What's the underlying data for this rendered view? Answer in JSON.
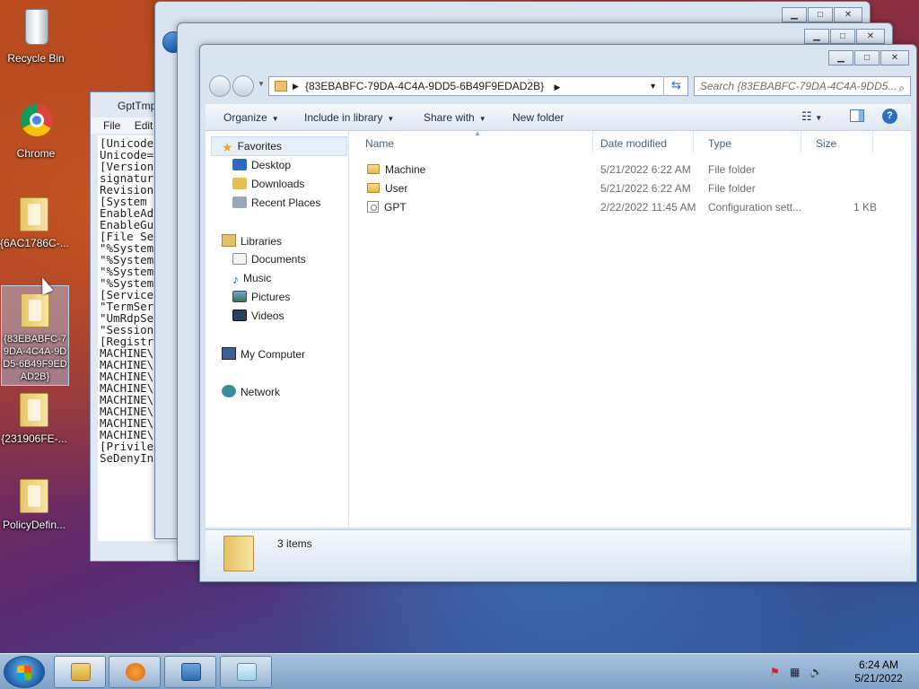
{
  "desktop": {
    "icons": [
      {
        "label": "Recycle Bin"
      },
      {
        "label": "Chrome"
      },
      {
        "label": "{6AC1786C-..."
      },
      {
        "label": "{83EBABFC-79DA-4C4A-9DD5-6B49F9EDAD2B}"
      },
      {
        "label": "{231906FE-..."
      },
      {
        "label": "PolicyDefin..."
      }
    ]
  },
  "notepad": {
    "title": "GptTmp",
    "menu": [
      "File",
      "Edit"
    ],
    "lines": [
      "[Unicode",
      "Unicode=",
      "[Version",
      "signatur",
      "Revision",
      "[System ",
      "EnableAd",
      "EnableGu",
      "[File Se",
      "\"%System",
      "\"%System",
      "\"%System",
      "\"%System",
      "[Service",
      "\"TermSer",
      "\"UmRdpSe",
      "\"Session",
      "[Registr",
      "MACHINE\\",
      "MACHINE\\",
      "MACHINE\\",
      "MACHINE\\",
      "MACHINE\\",
      "MACHINE\\",
      "MACHINE\\",
      "MACHINE\\",
      "[Privile",
      "SeDenyIn"
    ]
  },
  "explorer": {
    "address_path": "{83EBABFC-79DA-4C4A-9DD5-6B49F9EDAD2B}",
    "search_placeholder": "Search {83EBABFC-79DA-4C4A-9DD5...",
    "toolbar": {
      "organize": "Organize",
      "include_in_library": "Include in library",
      "share_with": "Share with",
      "new_folder": "New folder"
    },
    "nav": {
      "favorites": "Favorites",
      "favorites_items": [
        "Desktop",
        "Downloads",
        "Recent Places"
      ],
      "libraries": "Libraries",
      "libraries_items": [
        "Documents",
        "Music",
        "Pictures",
        "Videos"
      ],
      "my_computer": "My Computer",
      "network": "Network"
    },
    "columns": {
      "name": "Name",
      "date_modified": "Date modified",
      "type": "Type",
      "size": "Size"
    },
    "files": [
      {
        "name": "Machine",
        "date": "5/21/2022 6:22 AM",
        "type": "File folder",
        "size": "",
        "icon": "folder-icon"
      },
      {
        "name": "User",
        "date": "5/21/2022 6:22 AM",
        "type": "File folder",
        "size": "",
        "icon": "folder-icon"
      },
      {
        "name": "GPT",
        "date": "2/22/2022 11:45 AM",
        "type": "Configuration sett...",
        "size": "1 KB",
        "icon": "config-file-icon"
      }
    ],
    "status": "3 items"
  },
  "taskbar": {
    "time": "6:24 AM",
    "date": "5/21/2022"
  }
}
